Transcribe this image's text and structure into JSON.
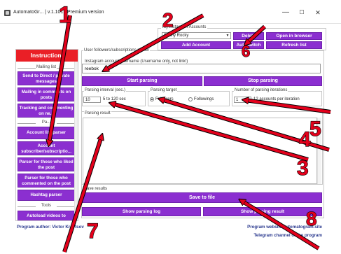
{
  "window": {
    "title": "AutomatoGr... | v.1.101 | Premium version",
    "controls": [
      "—",
      "☐",
      "✕"
    ]
  },
  "accounts": {
    "group_label": "My Instagram Accounts",
    "selected_account": "Sunny Rocky",
    "delete_label": "Delete",
    "open_browser_label": "Open in browser",
    "add_account_label": "Add Account",
    "autoswitch_label": "Autoswitch",
    "refresh_label": "Refresh list"
  },
  "sidebar": {
    "header": "Instructions",
    "sections": {
      "mailing": "Mailing list",
      "parsing": "Pa...",
      "tools": "Tools"
    },
    "items": [
      {
        "label": "Send to Direct / private messages"
      },
      {
        "label": "Mailing in comments on posts"
      },
      {
        "label": "Tracking and commenting on ne..."
      },
      {
        "label": "Account list parser"
      },
      {
        "label": "Account subscriber/subscriptio..."
      },
      {
        "label": "Parser for those who liked the post"
      },
      {
        "label": "Parser for those who commented on the post"
      },
      {
        "label": "Hashtag parser"
      },
      {
        "label": "Autoload videos to"
      }
    ]
  },
  "main": {
    "group_label": "User followers/subscriptions parser",
    "username_label": "Instagram account username (Username only, not link!)",
    "username_value": "reebok",
    "start_label": "Start parsing",
    "stop_label": "Stop parsing",
    "interval_label": "Parsing interval (sec.)",
    "interval_from": "10",
    "interval_to_text": "5 to 120 sec",
    "target_label": "Parsing target",
    "target_followers": "Followers",
    "target_followings": "Followings",
    "iterations_label": "Number of parsing iterations",
    "iterations_value": "1",
    "iterations_hint": "12 accounts per iteration",
    "result_label": "Parsing result",
    "save_results_label": "Save results",
    "save_to_file_label": "Save to file",
    "show_log_label": "Show parsing log",
    "show_result_label": "Show parsing result"
  },
  "footer": {
    "author": "Program author: Victor Kravtsov",
    "website": "Program website automatogram.site",
    "telegram": "Telegram channel of the program"
  },
  "annotations": {
    "numbers": [
      "1",
      "2",
      "3",
      "4",
      "5",
      "6",
      "7",
      "8"
    ],
    "color": "#e3001b",
    "stroke_color": "#000000"
  },
  "colors": {
    "accent_purple": "#8b2fd0",
    "header_red": "#ea1f26",
    "footer_blue": "#2b3a8f"
  }
}
